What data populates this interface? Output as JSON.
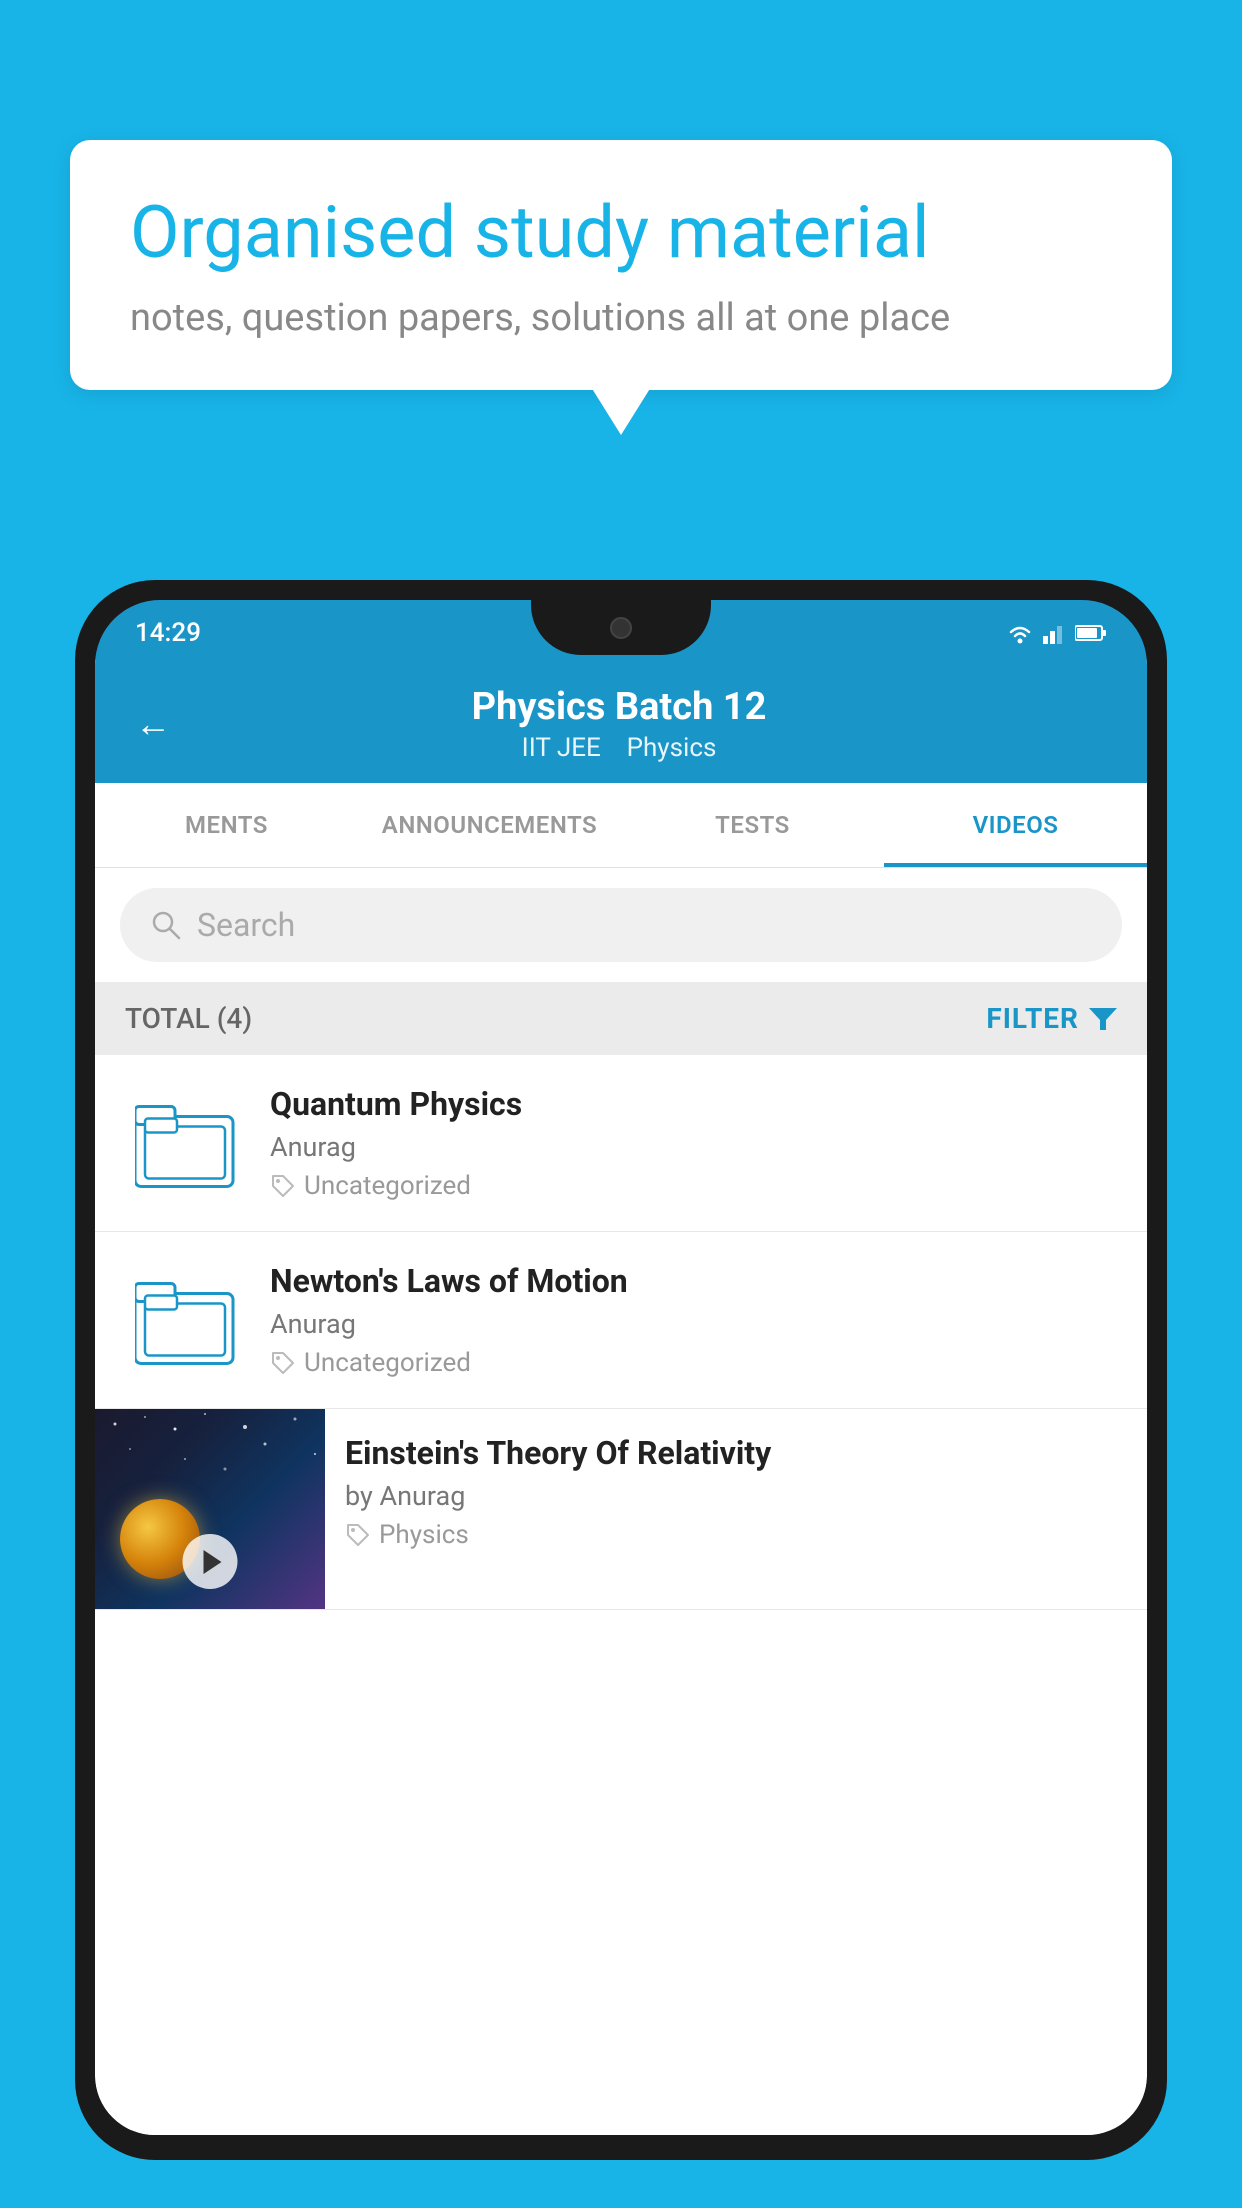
{
  "background": {
    "color": "#18b4e8"
  },
  "speech_bubble": {
    "title": "Organised study material",
    "subtitle": "notes, question papers, solutions all at one place"
  },
  "phone": {
    "status_bar": {
      "time": "14:29"
    },
    "header": {
      "title": "Physics Batch 12",
      "subtitle_part1": "IIT JEE",
      "subtitle_part2": "Physics",
      "back_label": "←"
    },
    "tabs": [
      {
        "label": "MENTS",
        "active": false
      },
      {
        "label": "ANNOUNCEMENTS",
        "active": false
      },
      {
        "label": "TESTS",
        "active": false
      },
      {
        "label": "VIDEOS",
        "active": true
      }
    ],
    "search": {
      "placeholder": "Search"
    },
    "filter_bar": {
      "total_label": "TOTAL (4)",
      "filter_label": "FILTER"
    },
    "videos": [
      {
        "id": 1,
        "title": "Quantum Physics",
        "author": "Anurag",
        "tag": "Uncategorized",
        "type": "folder"
      },
      {
        "id": 2,
        "title": "Newton's Laws of Motion",
        "author": "Anurag",
        "tag": "Uncategorized",
        "type": "folder"
      },
      {
        "id": 3,
        "title": "Einstein's Theory Of Relativity",
        "author": "by Anurag",
        "tag": "Physics",
        "type": "thumbnail"
      }
    ]
  }
}
